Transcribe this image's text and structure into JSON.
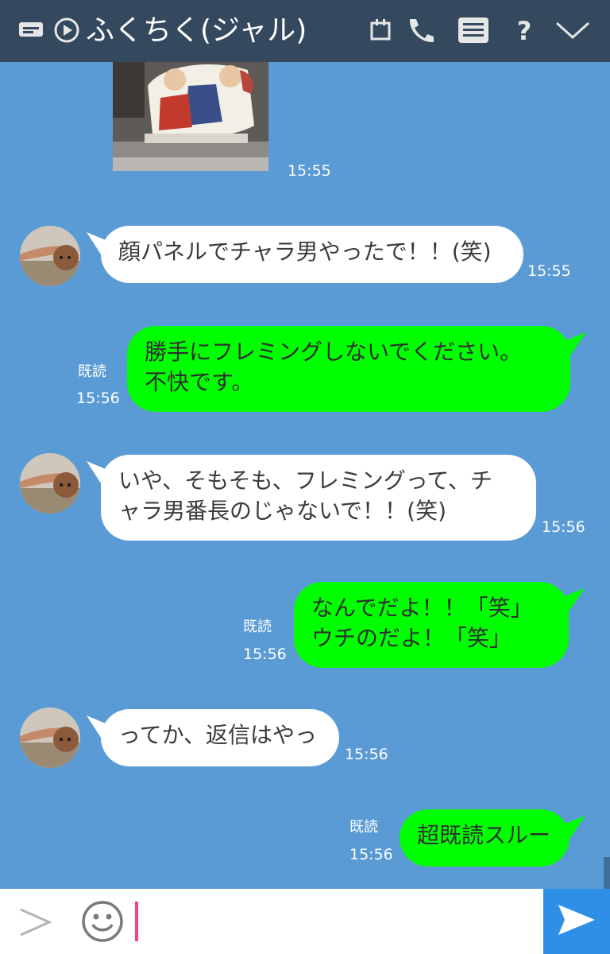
{
  "header": {
    "title": "ふくちく(ジャル)",
    "icons": [
      "chat-list-icon",
      "play-icon",
      "calendar-icon",
      "phone-icon",
      "menu-icon",
      "help-icon",
      "chevron-down-icon"
    ]
  },
  "chat": {
    "photo_time": "15:55",
    "messages": [
      {
        "side": "in",
        "lines": [
          "顔パネルでチャラ男やったで！！(笑)"
        ],
        "time": "15:55"
      },
      {
        "side": "out",
        "read": "既読",
        "lines": [
          "勝手にフレミングしないでください。",
          "不快です。"
        ],
        "time": "15:56"
      },
      {
        "side": "in",
        "lines": [
          "いや、そもそも、フレミングって、チ",
          "ャラ男番長のじゃないで！！(笑)"
        ],
        "time": "15:56"
      },
      {
        "side": "out",
        "read": "既読",
        "lines": [
          "なんでだよ！！「笑」",
          "ウチのだよ！「笑」"
        ],
        "time": "15:56"
      },
      {
        "side": "in",
        "lines": [
          "ってか、返信はやっ"
        ],
        "time": "15:56"
      },
      {
        "side": "out",
        "read": "既読",
        "lines": [
          "超既読スルー"
        ],
        "time": "15:56"
      }
    ]
  },
  "inputbar": {
    "icons": [
      "expand-icon",
      "emoji-icon",
      "send-icon"
    ]
  },
  "colors": {
    "header_bg": "#34495e",
    "chat_bg": "#5b9bd5",
    "outgoing_bubble": "#00ff00",
    "incoming_bubble": "#ffffff",
    "send_button": "#2d8fe6",
    "caret": "#ff3d7f"
  }
}
